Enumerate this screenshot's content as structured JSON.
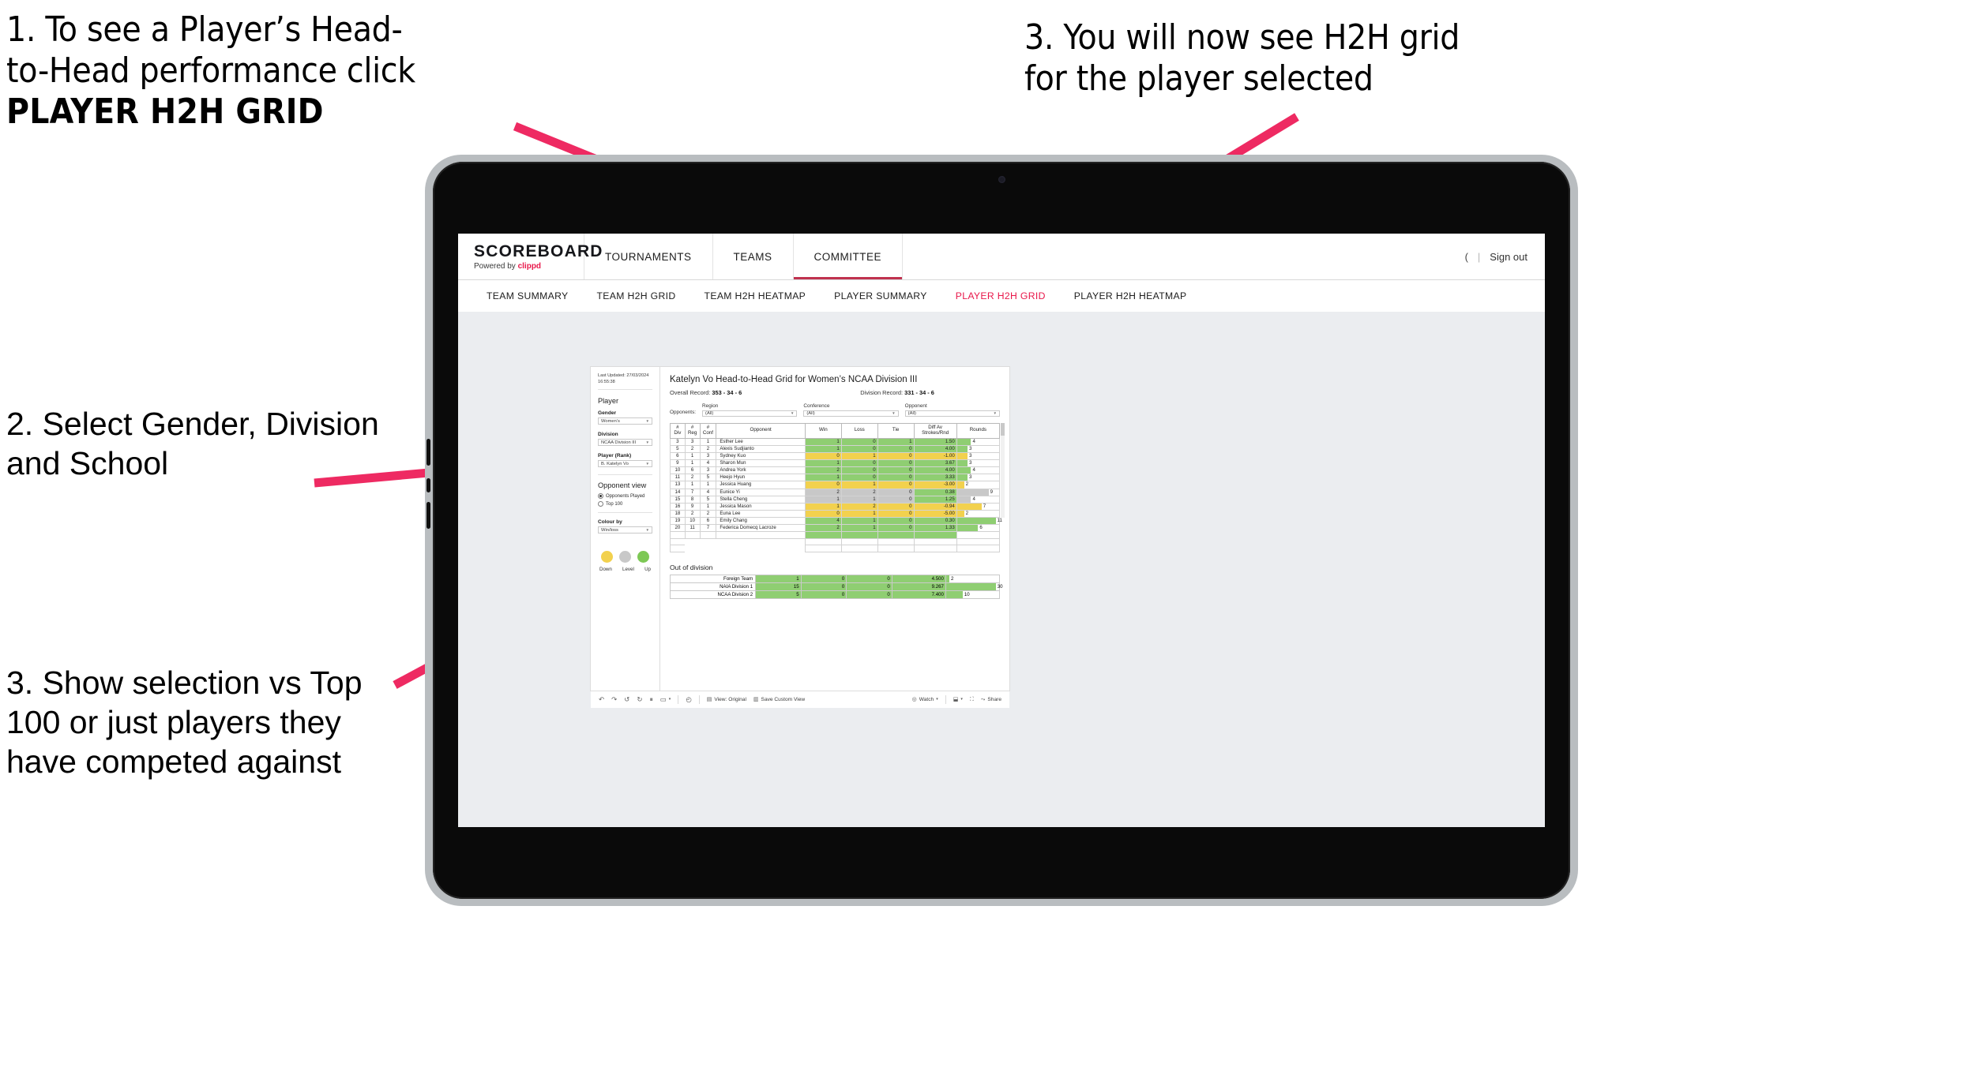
{
  "annotations": [
    {
      "id": "anno1",
      "line1": "1. To see a Player’s Head-",
      "line2": "to-Head performance click",
      "line3": "PLAYER H2H GRID"
    },
    {
      "id": "anno2",
      "line1": "3. You will now see H2H grid",
      "line2": "for the player selected"
    },
    {
      "id": "anno3",
      "text": "2. Select Gender, Division and School"
    },
    {
      "id": "anno4",
      "text": "3. Show selection vs Top 100 or just players they have competed against"
    }
  ],
  "colors": {
    "arrow_pink": "#ee2a62",
    "accent_red": "#e8174a",
    "win_green": "#8fce72",
    "loss_yellow": "#f2d14e",
    "level_grey": "#c8c8c8"
  },
  "app": {
    "logo": {
      "main": "SCOREBOARD",
      "sub_prefix": "Powered by ",
      "brand": "clippd"
    },
    "top_nav": [
      {
        "label": "TOURNAMENTS",
        "active": false
      },
      {
        "label": "TEAMS",
        "active": false
      },
      {
        "label": "COMMITTEE",
        "active": true
      }
    ],
    "user_chevron": ")",
    "divider": "|",
    "sign_out": "Sign out",
    "sub_nav": [
      {
        "label": "TEAM SUMMARY",
        "active": false
      },
      {
        "label": "TEAM H2H GRID",
        "active": false
      },
      {
        "label": "TEAM H2H HEATMAP",
        "active": false
      },
      {
        "label": "PLAYER SUMMARY",
        "active": false
      },
      {
        "label": "PLAYER H2H GRID",
        "active": true
      },
      {
        "label": "PLAYER H2H HEATMAP",
        "active": false
      }
    ]
  },
  "panel": {
    "last_updated_label": "Last Updated: 27/03/2024",
    "last_updated_time": "16:55:38",
    "section_title": "Player",
    "fields": [
      {
        "label": "Gender",
        "value": "Women’s"
      },
      {
        "label": "Division",
        "value": "NCAA Division III"
      },
      {
        "label": "Player (Rank)",
        "value": "B. Katelyn Vo"
      }
    ],
    "opponent_view": {
      "title": "Opponent view",
      "options": [
        {
          "label": "Opponents Played",
          "selected": true
        },
        {
          "label": "Top 100",
          "selected": false
        }
      ]
    },
    "colour_by": {
      "label": "Colour by",
      "value": "Win/loss"
    },
    "legend": [
      {
        "label": "Down",
        "color": "#f2d14e"
      },
      {
        "label": "Level",
        "color": "#c8c8c8"
      },
      {
        "label": "Up",
        "color": "#8fce72"
      }
    ]
  },
  "viz": {
    "title": "Katelyn Vo Head-to-Head Grid for Women’s NCAA Division III",
    "overall_record_label": "Overall Record:",
    "overall_record_value": "353 - 34 - 6",
    "division_record_label": "Division Record:",
    "division_record_value": "331 - 34 - 6",
    "opponents_label": "Opponents:",
    "filters": [
      {
        "caption": "Region",
        "value": "(All)"
      },
      {
        "caption": "Conference",
        "value": "(All)"
      },
      {
        "caption": "Opponent",
        "value": "(All)"
      }
    ]
  },
  "chart_data": {
    "type": "table",
    "title": "Katelyn Vo Head-to-Head Grid for Women’s NCAA Division III",
    "columns": [
      "# Div",
      "# Reg",
      "# Conf",
      "Opponent",
      "Win",
      "Loss",
      "Tie",
      "Diff Av Strokes/Rnd",
      "Rounds"
    ],
    "column_headers_multiline": [
      [
        "#",
        "Div"
      ],
      [
        "#",
        "Reg"
      ],
      [
        "#",
        "Conf"
      ],
      [
        "Opponent"
      ],
      [
        "Win"
      ],
      [
        "Loss"
      ],
      [
        "Tie"
      ],
      [
        "Diff Av",
        "Strokes/Rnd"
      ],
      [
        "Rounds"
      ]
    ],
    "rounds_max": 12,
    "rows": [
      {
        "div": "3",
        "reg": "3",
        "conf": "1",
        "opponent": "Esther Lee",
        "win": "1",
        "loss": "0",
        "tie": "1",
        "diff": "1.50",
        "rounds": "4",
        "state": "up"
      },
      {
        "div": "5",
        "reg": "2",
        "conf": "2",
        "opponent": "Alexis Sudjianto",
        "win": "1",
        "loss": "0",
        "tie": "0",
        "diff": "4.00",
        "rounds": "3",
        "state": "up"
      },
      {
        "div": "6",
        "reg": "1",
        "conf": "3",
        "opponent": "Sydney Kuo",
        "win": "0",
        "loss": "1",
        "tie": "0",
        "diff": "-1.00",
        "rounds": "3",
        "state": "down"
      },
      {
        "div": "9",
        "reg": "1",
        "conf": "4",
        "opponent": "Sharon Mun",
        "win": "1",
        "loss": "0",
        "tie": "0",
        "diff": "3.67",
        "rounds": "3",
        "state": "up"
      },
      {
        "div": "10",
        "reg": "6",
        "conf": "3",
        "opponent": "Andrea York",
        "win": "2",
        "loss": "0",
        "tie": "0",
        "diff": "4.00",
        "rounds": "4",
        "state": "up"
      },
      {
        "div": "11",
        "reg": "2",
        "conf": "5",
        "opponent": "Heejo Hyun",
        "win": "1",
        "loss": "0",
        "tie": "0",
        "diff": "3.33",
        "rounds": "3",
        "state": "up"
      },
      {
        "div": "13",
        "reg": "1",
        "conf": "1",
        "opponent": "Jessica Huang",
        "win": "0",
        "loss": "1",
        "tie": "0",
        "diff": "-3.00",
        "rounds": "2",
        "state": "down"
      },
      {
        "div": "14",
        "reg": "7",
        "conf": "4",
        "opponent": "Eunice Yi",
        "win": "2",
        "loss": "2",
        "tie": "0",
        "diff": "0.38",
        "rounds": "9",
        "state": "level",
        "diff_state": "up"
      },
      {
        "div": "15",
        "reg": "8",
        "conf": "5",
        "opponent": "Stella Cheng",
        "win": "1",
        "loss": "1",
        "tie": "0",
        "diff": "1.25",
        "rounds": "4",
        "state": "level",
        "diff_state": "up"
      },
      {
        "div": "16",
        "reg": "9",
        "conf": "1",
        "opponent": "Jessica Mason",
        "win": "1",
        "loss": "2",
        "tie": "0",
        "diff": "-0.94",
        "rounds": "7",
        "state": "down"
      },
      {
        "div": "18",
        "reg": "2",
        "conf": "2",
        "opponent": "Euna Lee",
        "win": "0",
        "loss": "1",
        "tie": "0",
        "diff": "-5.00",
        "rounds": "2",
        "state": "down"
      },
      {
        "div": "19",
        "reg": "10",
        "conf": "6",
        "opponent": "Emily Chang",
        "win": "4",
        "loss": "1",
        "tie": "0",
        "diff": "0.30",
        "rounds": "11",
        "state": "up"
      },
      {
        "div": "20",
        "reg": "11",
        "conf": "7",
        "opponent": "Federica Domecq Lacroze",
        "win": "2",
        "loss": "1",
        "tie": "0",
        "diff": "1.33",
        "rounds": "6",
        "state": "up"
      }
    ],
    "out_of_division": {
      "title": "Out of division",
      "rounds_max": 32,
      "rows": [
        {
          "opponent": "Foreign Team",
          "win": "1",
          "loss": "0",
          "tie": "0",
          "diff": "4.500",
          "rounds": "2",
          "state": "up"
        },
        {
          "opponent": "NAIA Division 1",
          "win": "15",
          "loss": "0",
          "tie": "0",
          "diff": "9.267",
          "rounds": "30",
          "state": "up"
        },
        {
          "opponent": "NCAA Division 2",
          "win": "5",
          "loss": "0",
          "tie": "0",
          "diff": "7.400",
          "rounds": "10",
          "state": "up"
        }
      ]
    }
  },
  "toolbar": {
    "undo": "↶",
    "redo": "↷",
    "revert": "↺",
    "refresh": "↻",
    "pause": "⏸",
    "alert": "▭",
    "caret": "▾",
    "clock": "◴",
    "view_label": "View: Original",
    "save_label": "Save Custom View",
    "watch_label": "Watch",
    "download_caret": "▾",
    "share_label": "Share"
  }
}
